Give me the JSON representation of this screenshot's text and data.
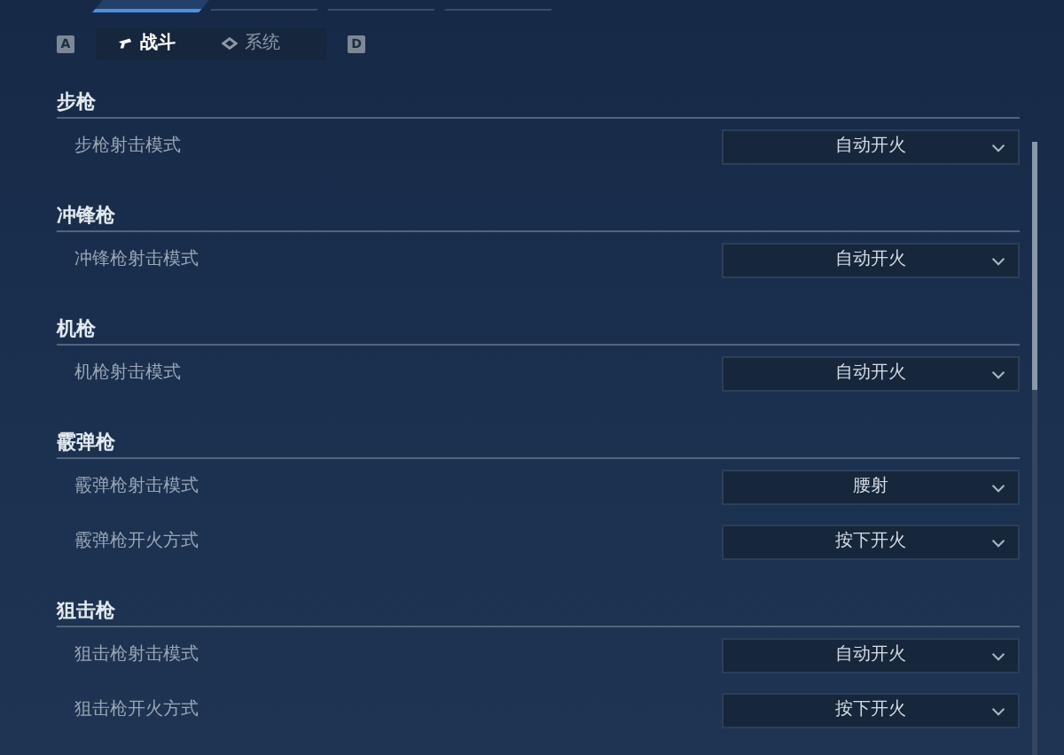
{
  "top_tabs": [
    {
      "selected": true
    },
    {
      "selected": false
    },
    {
      "selected": false
    },
    {
      "selected": false
    }
  ],
  "tab_bar": {
    "prev_key": "A",
    "next_key": "D",
    "tabs": [
      {
        "label": "战斗",
        "selected": true
      },
      {
        "label": "系统",
        "selected": false
      }
    ]
  },
  "sections": [
    {
      "title": "步枪",
      "settings": [
        {
          "label": "步枪射击模式",
          "value": "自动开火"
        }
      ]
    },
    {
      "title": "冲锋枪",
      "settings": [
        {
          "label": "冲锋枪射击模式",
          "value": "自动开火"
        }
      ]
    },
    {
      "title": "机枪",
      "settings": [
        {
          "label": "机枪射击模式",
          "value": "自动开火"
        }
      ]
    },
    {
      "title": "霰弹枪",
      "settings": [
        {
          "label": "霰弹枪射击模式",
          "value": "腰射"
        },
        {
          "label": "霰弹枪开火方式",
          "value": "按下开火"
        }
      ]
    },
    {
      "title": "狙击枪",
      "settings": [
        {
          "label": "狙击枪射击模式",
          "value": "自动开火"
        },
        {
          "label": "狙击枪开火方式",
          "value": "按下开火"
        }
      ]
    }
  ]
}
